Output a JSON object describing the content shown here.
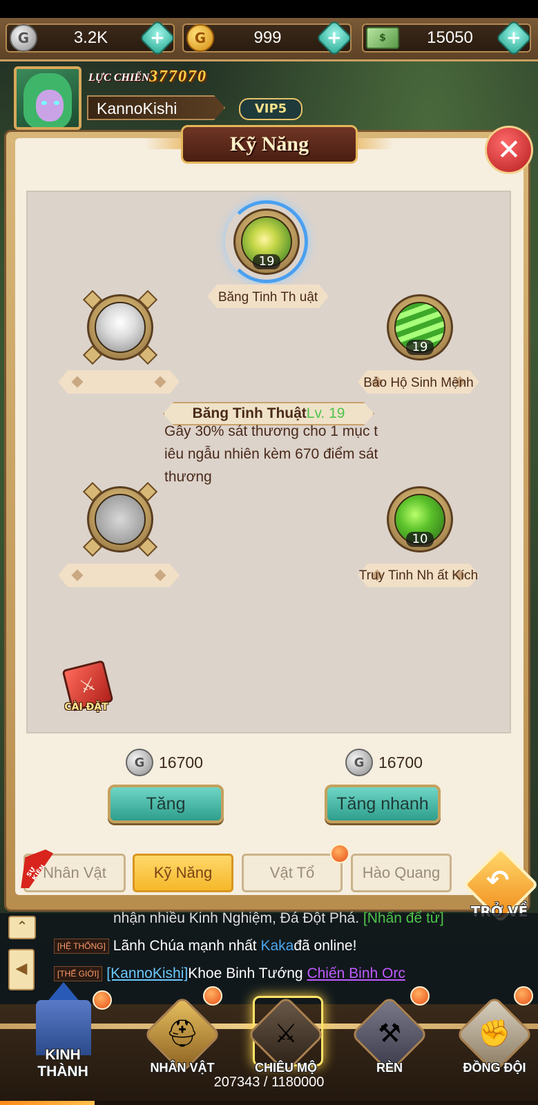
{
  "currencies": [
    {
      "icon": "silver-coin-icon",
      "amount": "3.2K"
    },
    {
      "icon": "gold-coin-icon",
      "amount": "999"
    },
    {
      "icon": "cash-icon",
      "amount": "15050"
    }
  ],
  "player": {
    "power_label": "LỰC CHIẾN",
    "power_value": "377070",
    "name": "KannoKishi",
    "vip": "VIP5"
  },
  "panel": {
    "title": "Kỹ Năng"
  },
  "skills": {
    "top": {
      "name": "Băng Tinh Th uật",
      "level": "19",
      "selected": true
    },
    "upper_left": {
      "name": "",
      "level": ""
    },
    "upper_right": {
      "name": "Bảo Hộ Sinh Mệnh",
      "level": "19"
    },
    "lower_left": {
      "name": "",
      "level": ""
    },
    "lower_right": {
      "name": "Truy Tinh Nh ất Kích",
      "level": "10"
    }
  },
  "tooltip": {
    "name": "Băng Tinh Thuật",
    "level": "Lv. 19",
    "description": "Gây 30% sát thương cho 1 mục tiêu ngẫu nhiên kèm 670 điểm sát thương"
  },
  "settings": {
    "label": "CÀI ĐẶT"
  },
  "costs": {
    "upgrade": "16700",
    "quick_upgrade": "16700"
  },
  "buttons": {
    "upgrade": "Tăng",
    "quick_upgrade": "Tăng nhanh",
    "back": "TRỞ VỀ"
  },
  "tabs": [
    {
      "label": "Nhân Vật",
      "active": false
    },
    {
      "label": "Kỹ Năng",
      "active": true
    },
    {
      "label": "Vật Tổ",
      "active": false
    },
    {
      "label": "Hào Quang",
      "active": false
    }
  ],
  "event_tag": "SỰ KIỆN",
  "chat": {
    "partial_line": "nhận nhiều Kinh Nghiệm, Đá Đột Phá.",
    "partial_link": "[Nhấn để từ]",
    "line1": {
      "tag": "[HỆ THỐNG]",
      "pre": "Lãnh Chúa mạnh nhất ",
      "player": "Kaka",
      "post": "đã online!"
    },
    "line2": {
      "tag": "[THẾ GIỚI]",
      "player": "[KannoKishi]",
      "mid": "Khoe Binh Tướng ",
      "item": "Chiến Binh Orc"
    }
  },
  "nav": {
    "items": [
      {
        "label": "KINH THÀNH"
      },
      {
        "label": "NHÂN VẬT"
      },
      {
        "label": "CHIÊU MỘ"
      },
      {
        "label": "RÈN"
      },
      {
        "label": "ĐỒNG ĐỘI"
      }
    ],
    "exp_text": "207343 / 1180000",
    "exp_fraction": 0.1757
  },
  "colors": {
    "accent_teal": "#2e9e8c",
    "active_tab": "#f5b82a",
    "level_green": "#4ec44a",
    "selection_blue": "#4aa0f0"
  }
}
